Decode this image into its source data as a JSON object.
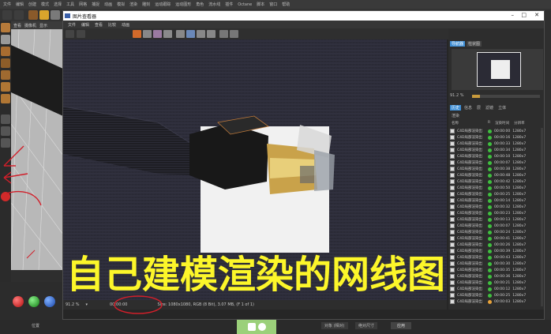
{
  "menubar": {
    "items": [
      "文件",
      "编辑",
      "创建",
      "模式",
      "选择",
      "工具",
      "网格",
      "捕捉",
      "动画",
      "模拟",
      "渲染",
      "雕刻",
      "运动跟踪",
      "运动图形",
      "角色",
      "流水线",
      "插件",
      "Octane",
      "脚本",
      "窗口",
      "帮助"
    ]
  },
  "viewport_menu": [
    "查看",
    "摄像机",
    "显示"
  ],
  "picture_viewer": {
    "title": "图片查看器",
    "menu": [
      "文件",
      "编辑",
      "查看",
      "比较",
      "动画"
    ],
    "zoom": "91.2 %",
    "timecode": "00:00:00",
    "status_text": "Size: 1080x1080, RGB (8 Bit), 3.07 MB, (F 1 of 1)",
    "right_tabs": [
      "导航器",
      "柱状图"
    ],
    "nav_zoom": "91.2 %",
    "info_tabs": [
      "历史",
      "信息",
      "层",
      "滤镜",
      "立体"
    ],
    "section_label": "渲染",
    "columns": [
      "名称",
      "R",
      "渲染时间",
      "分辨率"
    ],
    "history": [
      {
        "name": "C4D局部渲染出",
        "time": "00:00:00",
        "res": "1280x7",
        "status": "#3fbf3f"
      },
      {
        "name": "C4D局部渲染出",
        "time": "00:00:16",
        "res": "1280x7",
        "status": "#3fbf3f"
      },
      {
        "name": "C4D局部渲染出",
        "time": "00:00:33",
        "res": "1280x7",
        "status": "#3fbf3f"
      },
      {
        "name": "C4D局部渲染出",
        "time": "00:00:34",
        "res": "1280x7",
        "status": "#3fbf3f"
      },
      {
        "name": "C4D局部渲染出",
        "time": "00:00:10",
        "res": "1280x7",
        "status": "#3fbf3f"
      },
      {
        "name": "C4D局部渲染出",
        "time": "00:00:07",
        "res": "1280x7",
        "status": "#3fbf3f"
      },
      {
        "name": "C4D局部渲染出",
        "time": "00:00:38",
        "res": "1280x7",
        "status": "#3fbf3f"
      },
      {
        "name": "C4D局部渲染出",
        "time": "00:00:48",
        "res": "1280x7",
        "status": "#3fbf3f"
      },
      {
        "name": "C4D局部渲染出",
        "time": "00:00:42",
        "res": "1280x7",
        "status": "#3fbf3f"
      },
      {
        "name": "C4D局部渲染出",
        "time": "00:00:50",
        "res": "1280x7",
        "status": "#3fbf3f"
      },
      {
        "name": "C4D局部渲染出",
        "time": "00:00:25",
        "res": "1280x7",
        "status": "#3fbf3f"
      },
      {
        "name": "C4D局部渲染出",
        "time": "00:00:14",
        "res": "1280x7",
        "status": "#3fbf3f"
      },
      {
        "name": "C4D局部渲染出",
        "time": "00:00:32",
        "res": "1280x7",
        "status": "#3fbf3f"
      },
      {
        "name": "C4D局部渲染出",
        "time": "00:00:23",
        "res": "1280x7",
        "status": "#3fbf3f"
      },
      {
        "name": "C4D局部渲染出",
        "time": "00:00:13",
        "res": "1280x7",
        "status": "#3fbf3f"
      },
      {
        "name": "C4D局部渲染出",
        "time": "00:00:07",
        "res": "1280x7",
        "status": "#3fbf3f"
      },
      {
        "name": "C4D局部渲染出",
        "time": "00:00:24",
        "res": "1280x7",
        "status": "#3fbf3f"
      },
      {
        "name": "C4D局部渲染出",
        "time": "00:00:41",
        "res": "1280x7",
        "status": "#3fbf3f"
      },
      {
        "name": "C4D局部渲染出",
        "time": "00:00:26",
        "res": "1280x7",
        "status": "#3fbf3f"
      },
      {
        "name": "C4D局部渲染出",
        "time": "00:00:39",
        "res": "1280x7",
        "status": "#3fbf3f"
      },
      {
        "name": "C4D局部渲染出",
        "time": "00:00:43",
        "res": "1280x7",
        "status": "#3fbf3f"
      },
      {
        "name": "C4D局部渲染出",
        "time": "00:00:30",
        "res": "1280x7",
        "status": "#3fbf3f"
      },
      {
        "name": "C4D局部渲染出",
        "time": "00:00:35",
        "res": "1280x7",
        "status": "#3fbf3f"
      },
      {
        "name": "C4D局部渲染出",
        "time": "00:00:36",
        "res": "1280x7",
        "status": "#3fbf3f"
      },
      {
        "name": "C4D局部渲染出",
        "time": "00:00:21",
        "res": "1280x7",
        "status": "#3fbf3f"
      },
      {
        "name": "C4D局部渲染出",
        "time": "00:00:12",
        "res": "1280x7",
        "status": "#3fbf3f"
      },
      {
        "name": "C4D局部渲染出",
        "time": "00:00:25",
        "res": "1280x7",
        "status": "#3fbf3f"
      },
      {
        "name": "C4D局部渲染出",
        "time": "00:00:03",
        "res": "1280x7",
        "status": "#e8a33a"
      }
    ]
  },
  "caption": "自己建模渲染的网线图",
  "bottom": {
    "left_btn": "位置",
    "mid_btn": "对象 (相对)",
    "mid2_btn": "绝对尺寸",
    "apply": "应用"
  },
  "colors": {
    "caption": "#fcf62a",
    "annotation": "#d11f2a",
    "accent": "#3f8fd6"
  }
}
